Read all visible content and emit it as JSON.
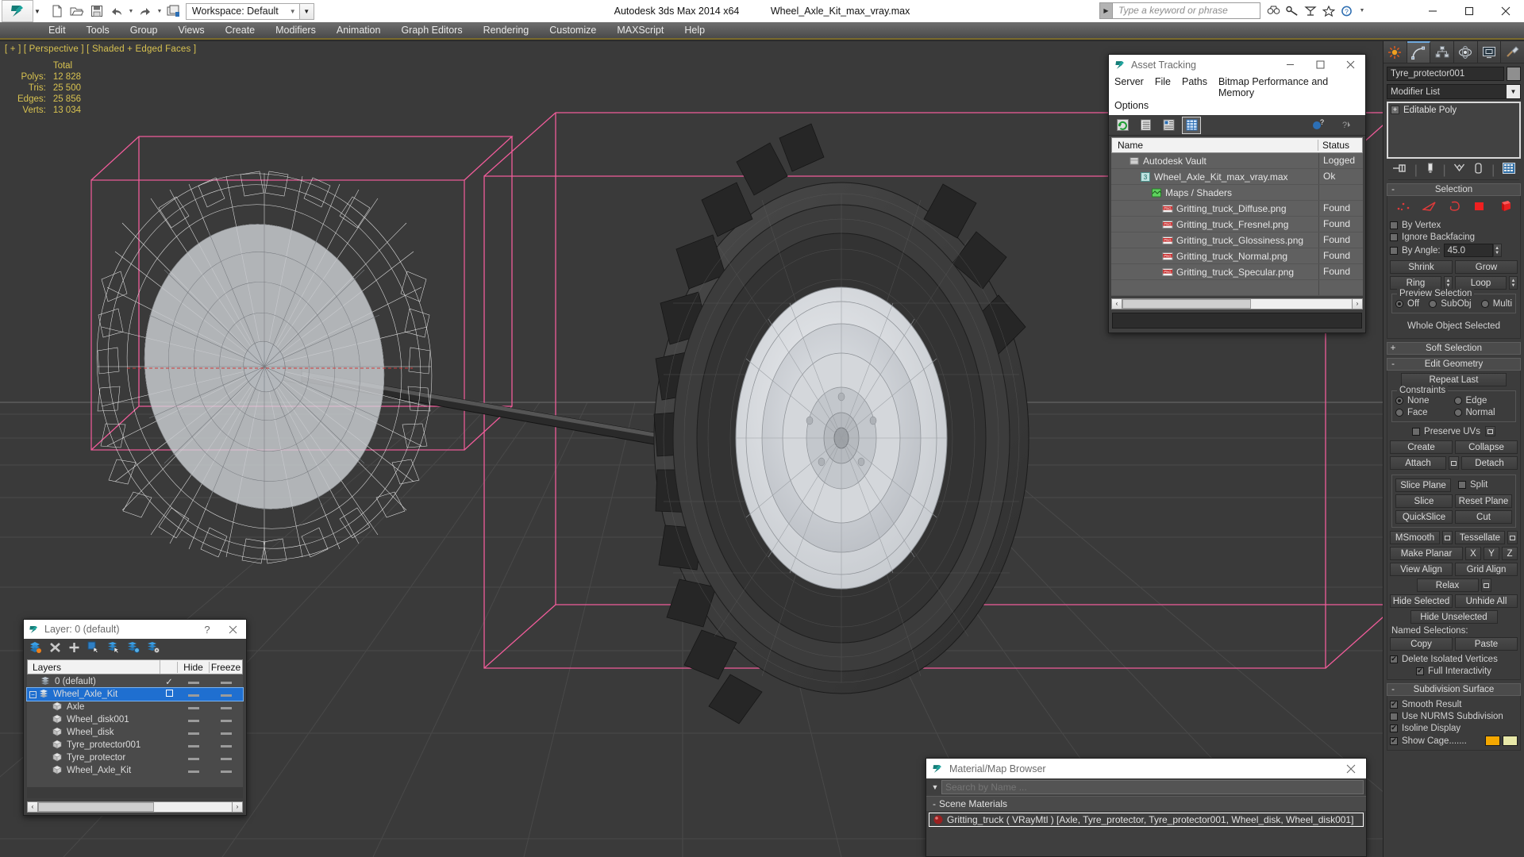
{
  "titlebar": {
    "app_title": "Autodesk 3ds Max  2014 x64",
    "file_name": "Wheel_Axle_Kit_max_vray.max",
    "workspace": "Workspace: Default",
    "search_placeholder": "Type a keyword or phrase",
    "quick_access": [
      "new-icon",
      "open-icon",
      "save-icon",
      "undo-icon",
      "redo-icon",
      "set-project-icon"
    ],
    "infocenter_icons": [
      "search-icon",
      "key-icon",
      "subscription-icon",
      "favorites-icon",
      "help-icon"
    ],
    "window_buttons": [
      "minimize",
      "maximize",
      "close"
    ]
  },
  "menubar": {
    "items": [
      "Edit",
      "Tools",
      "Group",
      "Views",
      "Create",
      "Modifiers",
      "Animation",
      "Graph Editors",
      "Rendering",
      "Customize",
      "MAXScript",
      "Help"
    ]
  },
  "viewport": {
    "label": "[ + ] [ Perspective ] [ Shaded + Edged Faces ]",
    "stats_header": "Total",
    "stats": [
      {
        "name": "Polys:",
        "value": "12 828"
      },
      {
        "name": "Tris:",
        "value": "25 500"
      },
      {
        "name": "Edges:",
        "value": "25 856"
      },
      {
        "name": "Verts:",
        "value": "13 034"
      }
    ],
    "text_color": "#d8c250",
    "background": "#3a3a3a"
  },
  "asset_tracking": {
    "title": "Asset Tracking",
    "menu": [
      "Server",
      "File",
      "Paths",
      "Bitmap Performance and Memory",
      "Options"
    ],
    "columns": [
      "Name",
      "Status"
    ],
    "rows": [
      {
        "name": "Autodesk Vault",
        "status": "Logged",
        "icon": "vault-icon",
        "indent": 1
      },
      {
        "name": "Wheel_Axle_Kit_max_vray.max",
        "status": "Ok",
        "icon": "max-icon",
        "indent": 2
      },
      {
        "name": "Maps / Shaders",
        "status": "",
        "icon": "maps-icon",
        "indent": 2
      },
      {
        "name": "Gritting_truck_Diffuse.png",
        "status": "Found",
        "icon": "png-icon",
        "indent": 3
      },
      {
        "name": "Gritting_truck_Fresnel.png",
        "status": "Found",
        "icon": "png-icon",
        "indent": 3
      },
      {
        "name": "Gritting_truck_Glossiness.png",
        "status": "Found",
        "icon": "png-icon",
        "indent": 3
      },
      {
        "name": "Gritting_truck_Normal.png",
        "status": "Found",
        "icon": "png-icon",
        "indent": 3
      },
      {
        "name": "Gritting_truck_Specular.png",
        "status": "Found",
        "icon": "png-icon",
        "indent": 3
      }
    ]
  },
  "layer_dialog": {
    "title": "Layer: 0 (default)",
    "help_label": "?",
    "columns": [
      "Layers",
      "Hide",
      "Freeze"
    ],
    "rows": [
      {
        "name": "0 (default)",
        "current": true,
        "selected": false,
        "indent": 1,
        "icon": "layer-icon"
      },
      {
        "name": "Wheel_Axle_Kit",
        "current": false,
        "selected": true,
        "indent": 1,
        "icon": "layer-icon"
      },
      {
        "name": "Axle",
        "current": false,
        "selected": false,
        "indent": 2,
        "icon": "object-icon"
      },
      {
        "name": "Wheel_disk001",
        "current": false,
        "selected": false,
        "indent": 2,
        "icon": "object-icon"
      },
      {
        "name": "Wheel_disk",
        "current": false,
        "selected": false,
        "indent": 2,
        "icon": "object-icon"
      },
      {
        "name": "Tyre_protector001",
        "current": false,
        "selected": false,
        "indent": 2,
        "icon": "object-icon"
      },
      {
        "name": "Tyre_protector",
        "current": false,
        "selected": false,
        "indent": 2,
        "icon": "object-icon"
      },
      {
        "name": "Wheel_Axle_Kit",
        "current": false,
        "selected": false,
        "indent": 2,
        "icon": "object-icon"
      }
    ]
  },
  "material_browser": {
    "title": "Material/Map Browser",
    "search_placeholder": "Search by Name ...",
    "group_label": "Scene Materials",
    "group_toggle": "-",
    "items": [
      {
        "label": "Gritting_truck  ( VRayMtl )  [Axle, Tyre_protector, Tyre_protector001, Wheel_disk, Wheel_disk001]",
        "selected": true
      }
    ]
  },
  "command_panel": {
    "tabs": [
      "create-tab",
      "modify-tab",
      "hierarchy-tab",
      "motion-tab",
      "display-tab",
      "utilities-tab"
    ],
    "active_tab_index": 1,
    "object_name": "Tyre_protector001",
    "modifier_list_label": "Modifier List",
    "stack": [
      {
        "label": "Editable Poly"
      }
    ],
    "selection": {
      "title": "Selection",
      "toggle": "-",
      "sub_object_icons": [
        "vertex-icon",
        "edge-icon",
        "border-icon",
        "polygon-icon",
        "element-icon"
      ],
      "checkboxes": [
        {
          "label": "By Vertex",
          "checked": false
        },
        {
          "label": "Ignore Backfacing",
          "checked": false
        },
        {
          "label": "By Angle:",
          "checked": false,
          "value": "45.0"
        }
      ],
      "buttons": [
        "Shrink",
        "Grow",
        "Ring",
        "Loop"
      ],
      "preview_group": "Preview Selection",
      "preview_options": [
        {
          "label": "Off",
          "selected": true
        },
        {
          "label": "SubObj",
          "selected": false
        },
        {
          "label": "Multi",
          "selected": false
        }
      ],
      "status": "Whole Object Selected"
    },
    "soft_selection": {
      "title": "Soft Selection",
      "toggle": "+"
    },
    "edit_geometry": {
      "title": "Edit Geometry",
      "toggle": "-",
      "repeat_last": "Repeat Last",
      "constraints_label": "Constraints",
      "constraints": [
        {
          "label": "None",
          "selected": true
        },
        {
          "label": "Edge",
          "selected": false
        },
        {
          "label": "Face",
          "selected": false
        },
        {
          "label": "Normal",
          "selected": false
        }
      ],
      "preserve_uvs": {
        "label": "Preserve UVs",
        "checked": false
      },
      "buttons_rows": [
        [
          "Create",
          "Collapse"
        ],
        [
          "Attach",
          "Detach"
        ],
        [
          "Slice Plane",
          "Split"
        ],
        [
          "Slice",
          "Reset Plane"
        ],
        [
          "QuickSlice",
          "Cut"
        ],
        [
          "MSmooth",
          "Tessellate"
        ],
        [
          "Make Planar",
          "X",
          "Y",
          "Z"
        ],
        [
          "View Align",
          "Grid Align"
        ],
        [
          "Relax"
        ],
        [
          "Hide Selected",
          "Unhide All"
        ],
        [
          "Hide Unselected"
        ]
      ],
      "named_selections_label": "Named Selections:",
      "named_buttons": [
        "Copy",
        "Paste"
      ],
      "delete_isolated": {
        "label": "Delete Isolated Vertices",
        "checked": true
      },
      "full_interactivity": {
        "label": "Full Interactivity",
        "checked": true
      }
    },
    "subdivision_surface": {
      "title": "Subdivision Surface",
      "toggle": "-",
      "checkboxes": [
        {
          "label": "Smooth Result",
          "checked": true
        },
        {
          "label": "Use NURMS Subdivision",
          "checked": false
        },
        {
          "label": "Isoline Display",
          "checked": true
        },
        {
          "label": "Show Cage.......",
          "checked": true
        }
      ],
      "cage_colors": [
        "#f5a800",
        "#e8e8a8"
      ]
    }
  },
  "colors": {
    "viewport_bg": "#3a3a3a",
    "panel_bg": "#3c3c3c",
    "accent_yellow": "#d8c250",
    "selection_blue": "#1f6fd0",
    "gizmo_pink": "#f05c9a",
    "titlebar_bg": "#ffffff"
  }
}
